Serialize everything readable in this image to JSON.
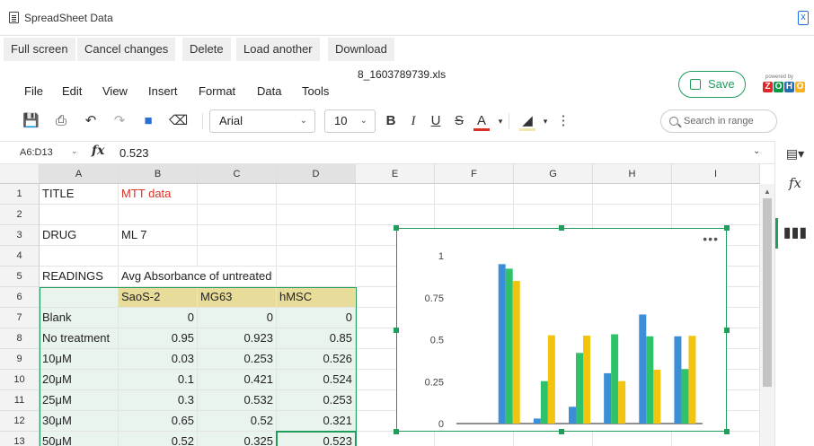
{
  "window": {
    "title": "SpreadSheet Data",
    "close_icon": "x"
  },
  "topbar": {
    "buttons": [
      "Full screen",
      "Cancel changes",
      "Delete",
      "Load another",
      "Download"
    ]
  },
  "file": {
    "name": "8_1603789739.xls"
  },
  "menu": [
    "File",
    "Edit",
    "View",
    "Insert",
    "Format",
    "Data",
    "Tools"
  ],
  "save": {
    "label": "Save"
  },
  "brand": {
    "powered_by": "powered by",
    "letters": [
      "Z",
      "O",
      "H",
      "O"
    ],
    "colors": [
      "#e42527",
      "#089949",
      "#226db4",
      "#f9b21d"
    ]
  },
  "toolbar": {
    "font": "Arial",
    "size": "10",
    "bold": "B",
    "italic": "I",
    "underline": "U",
    "strike": "S",
    "textcolor": "A",
    "search_placeholder": "Search in range"
  },
  "formula": {
    "ref": "A6:D13",
    "value": "0.523",
    "fx": "fx"
  },
  "sidepanel": {
    "fx": "fx"
  },
  "columns": [
    "A",
    "B",
    "C",
    "D",
    "E",
    "F",
    "G",
    "H",
    "I"
  ],
  "rows": [
    {
      "n": "1",
      "cells": [
        "TITLE",
        "MTT data",
        "",
        ""
      ]
    },
    {
      "n": "2",
      "cells": [
        "",
        "",
        "",
        ""
      ]
    },
    {
      "n": "3",
      "cells": [
        "DRUG",
        "ML 7",
        "",
        ""
      ]
    },
    {
      "n": "4",
      "cells": [
        "",
        "",
        "",
        ""
      ]
    },
    {
      "n": "5",
      "cells": [
        "READINGS",
        "Avg Absorbance of untreated",
        "",
        ""
      ]
    },
    {
      "n": "6",
      "cells": [
        "",
        "SaoS-2",
        "MG63",
        "hMSC"
      ]
    },
    {
      "n": "7",
      "cells": [
        "Blank",
        "0",
        "0",
        "0"
      ]
    },
    {
      "n": "8",
      "cells": [
        "No treatment",
        "0.95",
        "0.923",
        "0.85"
      ]
    },
    {
      "n": "9",
      "cells": [
        "10μM",
        "0.03",
        "0.253",
        "0.526"
      ]
    },
    {
      "n": "10",
      "cells": [
        "20μM",
        "0.1",
        "0.421",
        "0.524"
      ]
    },
    {
      "n": "11",
      "cells": [
        "25μM",
        "0.3",
        "0.532",
        "0.253"
      ]
    },
    {
      "n": "12",
      "cells": [
        "30μM",
        "0.65",
        "0.52",
        "0.321"
      ]
    },
    {
      "n": "13",
      "cells": [
        "50μM",
        "0.52",
        "0.325",
        "0.523"
      ]
    }
  ],
  "chart_data": {
    "type": "bar",
    "categories": [
      "Blank",
      "No treatment",
      "10μM",
      "20μM",
      "25μM",
      "30μM",
      "50μM"
    ],
    "series": [
      {
        "name": "SaoS-2",
        "values": [
          0,
          0.95,
          0.03,
          0.1,
          0.3,
          0.65,
          0.52
        ],
        "color": "#3b8fd9"
      },
      {
        "name": "MG63",
        "values": [
          0,
          0.923,
          0.253,
          0.421,
          0.532,
          0.52,
          0.325
        ],
        "color": "#2ec36a"
      },
      {
        "name": "hMSC",
        "values": [
          0,
          0.85,
          0.526,
          0.524,
          0.253,
          0.321,
          0.523
        ],
        "color": "#f2c40f"
      }
    ],
    "ylim": [
      0,
      1
    ],
    "yticks": [
      "0",
      "0.25",
      "0.5",
      "0.75",
      "1"
    ],
    "grid": false,
    "legend": "none",
    "title": "",
    "xlabel": "",
    "ylabel": ""
  }
}
